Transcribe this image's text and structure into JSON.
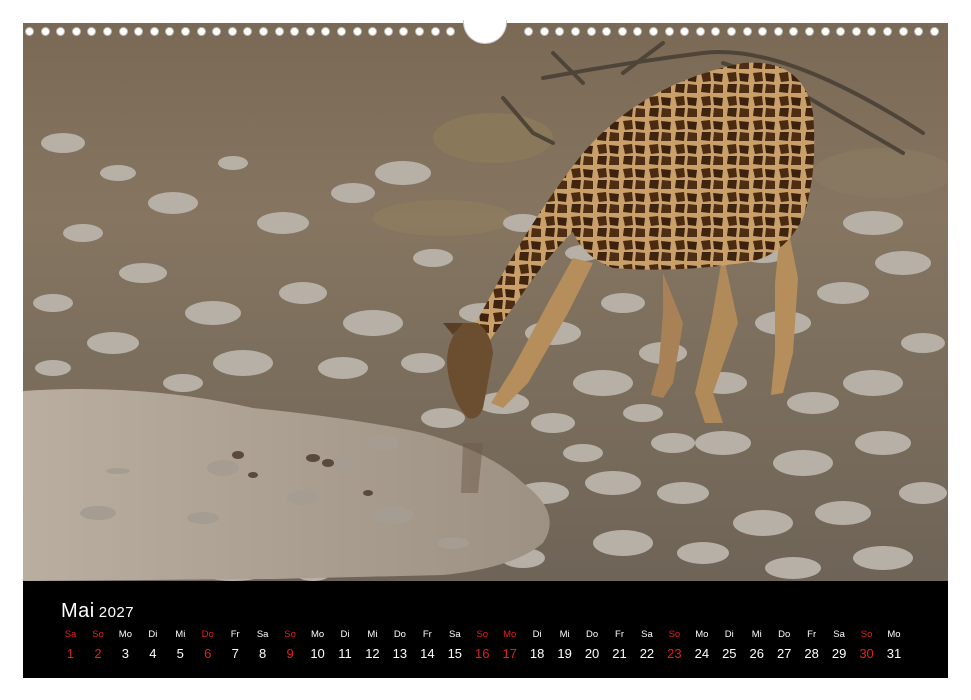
{
  "calendar": {
    "month": "Mai",
    "year": "2027",
    "days": [
      {
        "dn": "Sa",
        "d": "1",
        "sunday": true
      },
      {
        "dn": "So",
        "d": "2",
        "sunday": true
      },
      {
        "dn": "Mo",
        "d": "3",
        "sunday": false
      },
      {
        "dn": "Di",
        "d": "4",
        "sunday": false
      },
      {
        "dn": "Mi",
        "d": "5",
        "sunday": false
      },
      {
        "dn": "Do",
        "d": "6",
        "sunday": true
      },
      {
        "dn": "Fr",
        "d": "7",
        "sunday": false
      },
      {
        "dn": "Sa",
        "d": "8",
        "sunday": false
      },
      {
        "dn": "So",
        "d": "9",
        "sunday": true
      },
      {
        "dn": "Mo",
        "d": "10",
        "sunday": false
      },
      {
        "dn": "Di",
        "d": "11",
        "sunday": false
      },
      {
        "dn": "Mi",
        "d": "12",
        "sunday": false
      },
      {
        "dn": "Do",
        "d": "13",
        "sunday": false
      },
      {
        "dn": "Fr",
        "d": "14",
        "sunday": false
      },
      {
        "dn": "Sa",
        "d": "15",
        "sunday": false
      },
      {
        "dn": "So",
        "d": "16",
        "sunday": true
      },
      {
        "dn": "Mo",
        "d": "17",
        "sunday": true
      },
      {
        "dn": "Di",
        "d": "18",
        "sunday": false
      },
      {
        "dn": "Mi",
        "d": "19",
        "sunday": false
      },
      {
        "dn": "Do",
        "d": "20",
        "sunday": false
      },
      {
        "dn": "Fr",
        "d": "21",
        "sunday": false
      },
      {
        "dn": "Sa",
        "d": "22",
        "sunday": false
      },
      {
        "dn": "So",
        "d": "23",
        "sunday": true
      },
      {
        "dn": "Mo",
        "d": "24",
        "sunday": false
      },
      {
        "dn": "Di",
        "d": "25",
        "sunday": false
      },
      {
        "dn": "Mi",
        "d": "26",
        "sunday": false
      },
      {
        "dn": "Do",
        "d": "27",
        "sunday": false
      },
      {
        "dn": "Fr",
        "d": "28",
        "sunday": false
      },
      {
        "dn": "Sa",
        "d": "29",
        "sunday": false
      },
      {
        "dn": "So",
        "d": "30",
        "sunday": true
      },
      {
        "dn": "Mo",
        "d": "31",
        "sunday": false
      }
    ]
  },
  "colors": {
    "holiday_red": "#e02020",
    "bar_bg": "#000000",
    "text": "#ffffff"
  },
  "photo": {
    "subject": "giraffe-drinking-at-waterhole"
  }
}
